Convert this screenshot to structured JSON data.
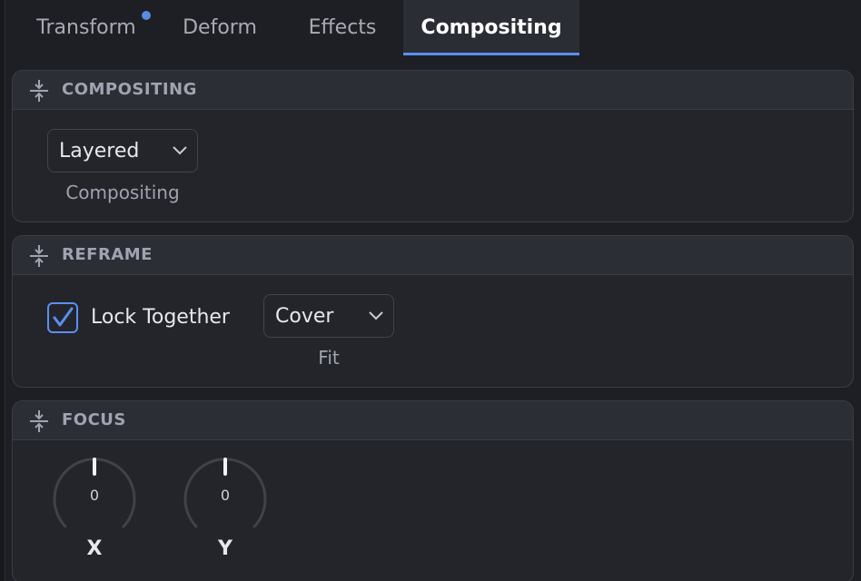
{
  "tabs": [
    {
      "label": "Transform",
      "has_indicator": true
    },
    {
      "label": "Deform"
    },
    {
      "label": "Effects"
    },
    {
      "label": "Compositing",
      "active": true
    }
  ],
  "colors": {
    "accent": "#5b8ef0",
    "panel_bg": "#23252b",
    "header_bg": "#2c2e36",
    "text": "#e6e8ed",
    "muted_text": "#9ea3ae"
  },
  "sections": {
    "compositing": {
      "title": "COMPOSITING",
      "icon": "collapse-icon",
      "dropdown_value": "Layered",
      "dropdown_caption": "Compositing"
    },
    "reframe": {
      "title": "REFRAME",
      "icon": "collapse-icon",
      "checkbox_label": "Lock Together",
      "checkbox_checked": true,
      "dropdown_value": "Cover",
      "dropdown_caption": "Fit"
    },
    "focus": {
      "title": "FOCUS",
      "icon": "collapse-icon",
      "knobs": [
        {
          "label": "X",
          "value": "0"
        },
        {
          "label": "Y",
          "value": "0"
        }
      ]
    }
  }
}
